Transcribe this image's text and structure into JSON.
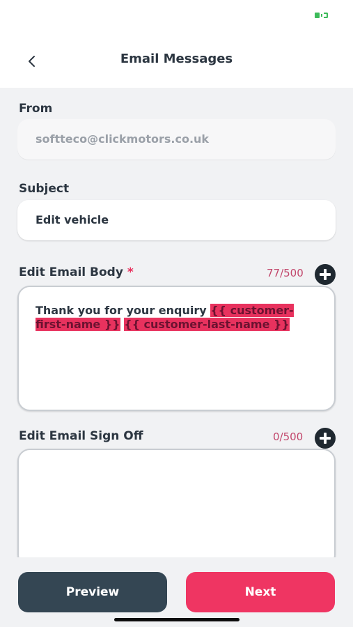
{
  "header": {
    "title": "Email Messages",
    "back_icon": "chevron-left-icon"
  },
  "form": {
    "from": {
      "label": "From",
      "value": "softteco@clickmotors.co.uk"
    },
    "subject": {
      "label": "Subject",
      "value": "Edit vehicle"
    },
    "body": {
      "label": "Edit Email Body",
      "required_mark": "*",
      "counter": "77/500",
      "text": "Thank you for your enquiry",
      "tags": [
        "{{ customer-first-name }}",
        "{{ customer-last-name }}"
      ],
      "add_icon": "plus-circle-icon"
    },
    "sign_off": {
      "label": "Edit Email Sign Off",
      "counter": "0/500",
      "value": "",
      "add_icon": "plus-circle-icon"
    }
  },
  "actions": {
    "preview_label": "Preview",
    "next_label": "Next"
  },
  "colors": {
    "accent": "#ef3562",
    "secondary_button": "#344653",
    "text": "#2c3641",
    "battery": "#3dbb5a"
  }
}
